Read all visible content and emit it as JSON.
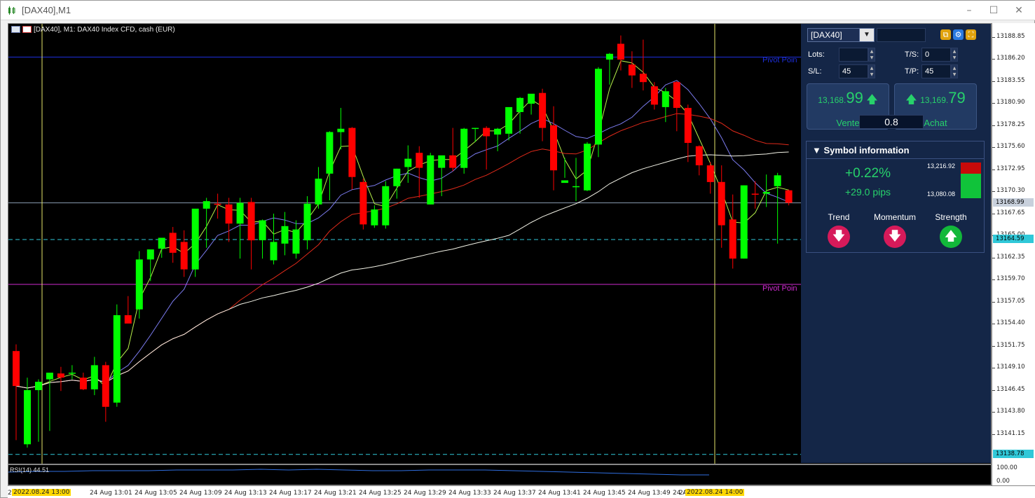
{
  "window": {
    "title": "[DAX40],M1",
    "icon": "chart-candles-icon",
    "colors": {
      "bg": "#000000",
      "panel": "#142647",
      "bull": "#00ff00",
      "bear": "#ff0000",
      "accent_green": "#27d16b"
    }
  },
  "chart": {
    "header": "[DAX40], M1:  DAX40 Index CFD, cash (EUR)",
    "pivot_label_1": "Pivot Poin",
    "pivot_label_2": "Pivot Poin",
    "rsi_label": "RSI(14) 44.51",
    "price_labels": [
      "13188.85",
      "13186.20",
      "13183.55",
      "13180.90",
      "13178.25",
      "13175.60",
      "13172.95",
      "13170.30",
      "13167.65",
      "13165.00",
      "13162.35",
      "13159.70",
      "13157.05",
      "13154.40",
      "13151.75",
      "13149.10",
      "13146.45",
      "13143.80",
      "13141.15"
    ],
    "current_price_badge": "13168.99",
    "cyan_badge": "13164.59",
    "low_badge": "13138.78",
    "rsi_scale_top": "100.00",
    "rsi_scale_bottom": "0.00",
    "time_labels": [
      "24 Aug 13:01",
      "24 Aug 13:05",
      "24 Aug 13:09",
      "24 Aug 13:13",
      "24 Aug 13:17",
      "24 Aug 13:21",
      "24 Aug 13:25",
      "24 Aug 13:29",
      "24 Aug 13:33",
      "24 Aug 13:37",
      "24 Aug 13:41",
      "24 Aug 13:45",
      "24 Aug 13:49",
      "24 Aug 13:53"
    ],
    "time_left_prefix": "24",
    "time_right_prefix": "24",
    "time_marker_start": "2022.08.24 13:00",
    "time_marker_end": "2022.08.24 14:00"
  },
  "chart_data": {
    "type": "candlestick",
    "ylim": [
      13137.5,
      13190.5
    ],
    "candles": [
      {
        "o": 13151.2,
        "h": 13152.0,
        "l": 13140.5,
        "c": 13147.0
      },
      {
        "o": 13140.0,
        "h": 13148.0,
        "l": 13139.6,
        "c": 13146.5
      },
      {
        "o": 13146.5,
        "h": 13147.8,
        "l": 13140.3,
        "c": 13147.5
      },
      {
        "o": 13147.8,
        "h": 13148.3,
        "l": 13141.6,
        "c": 13148.6
      },
      {
        "o": 13148.5,
        "h": 13149.3,
        "l": 13146.4,
        "c": 13148.0
      },
      {
        "o": 13148.6,
        "h": 13149.5,
        "l": 13147.8,
        "c": 13148.6
      },
      {
        "o": 13148.0,
        "h": 13148.6,
        "l": 13146.5,
        "c": 13146.6
      },
      {
        "o": 13146.6,
        "h": 13150.5,
        "l": 13145.9,
        "c": 13149.5
      },
      {
        "o": 13149.5,
        "h": 13149.9,
        "l": 13142.7,
        "c": 13144.5
      },
      {
        "o": 13145.0,
        "h": 13156.8,
        "l": 13144.5,
        "c": 13155.5
      },
      {
        "o": 13155.5,
        "h": 13157.8,
        "l": 13154.7,
        "c": 13154.5
      },
      {
        "o": 13156.2,
        "h": 13163.2,
        "l": 13155.1,
        "c": 13162.2
      },
      {
        "o": 13162.2,
        "h": 13163.2,
        "l": 13159.6,
        "c": 13163.4
      },
      {
        "o": 13163.5,
        "h": 13164.4,
        "l": 13162.4,
        "c": 13164.8
      },
      {
        "o": 13165.4,
        "h": 13166.1,
        "l": 13161.8,
        "c": 13163.0
      },
      {
        "o": 13164.3,
        "h": 13165.7,
        "l": 13160.1,
        "c": 13161.0
      },
      {
        "o": 13161.0,
        "h": 13168.0,
        "l": 13160.1,
        "c": 13168.3
      },
      {
        "o": 13168.3,
        "h": 13169.6,
        "l": 13163.6,
        "c": 13169.2
      },
      {
        "o": 13168.9,
        "h": 13170.1,
        "l": 13167.1,
        "c": 13168.8
      },
      {
        "o": 13168.8,
        "h": 13169.6,
        "l": 13164.3,
        "c": 13166.5
      },
      {
        "o": 13166.5,
        "h": 13169.6,
        "l": 13162.3,
        "c": 13169.0
      },
      {
        "o": 13169.1,
        "h": 13169.6,
        "l": 13161.0,
        "c": 13164.5
      },
      {
        "o": 13164.5,
        "h": 13167.0,
        "l": 13162.3,
        "c": 13166.9
      },
      {
        "o": 13162.1,
        "h": 13167.7,
        "l": 13161.6,
        "c": 13164.3
      },
      {
        "o": 13164.1,
        "h": 13167.9,
        "l": 13162.7,
        "c": 13166.2
      },
      {
        "o": 13162.9,
        "h": 13166.9,
        "l": 13162.3,
        "c": 13165.8
      },
      {
        "o": 13164.5,
        "h": 13169.8,
        "l": 13163.4,
        "c": 13168.9
      },
      {
        "o": 13168.8,
        "h": 13173.3,
        "l": 13168.3,
        "c": 13171.9
      },
      {
        "o": 13172.5,
        "h": 13177.6,
        "l": 13169.3,
        "c": 13177.5
      },
      {
        "o": 13177.5,
        "h": 13180.4,
        "l": 13175.4,
        "c": 13177.9
      },
      {
        "o": 13178.0,
        "h": 13178.1,
        "l": 13170.6,
        "c": 13172.1
      },
      {
        "o": 13171.5,
        "h": 13171.9,
        "l": 13165.8,
        "c": 13166.4
      },
      {
        "o": 13166.3,
        "h": 13168.7,
        "l": 13166.0,
        "c": 13168.2
      },
      {
        "o": 13166.3,
        "h": 13171.6,
        "l": 13165.9,
        "c": 13171.0
      },
      {
        "o": 13171.0,
        "h": 13173.1,
        "l": 13169.5,
        "c": 13173.1
      },
      {
        "o": 13173.3,
        "h": 13175.9,
        "l": 13171.4,
        "c": 13174.3
      },
      {
        "o": 13175.0,
        "h": 13175.8,
        "l": 13169.6,
        "c": 13173.2
      },
      {
        "o": 13168.8,
        "h": 13175.0,
        "l": 13168.8,
        "c": 13174.7
      },
      {
        "o": 13173.2,
        "h": 13173.6,
        "l": 13169.8,
        "c": 13174.7
      },
      {
        "o": 13174.7,
        "h": 13178.0,
        "l": 13172.8,
        "c": 13173.2
      },
      {
        "o": 13173.2,
        "h": 13178.0,
        "l": 13172.5,
        "c": 13177.9
      },
      {
        "o": 13177.9,
        "h": 13178.0,
        "l": 13176.3,
        "c": 13178.0
      },
      {
        "o": 13178.0,
        "h": 13178.2,
        "l": 13173.0,
        "c": 13177.0
      },
      {
        "o": 13177.2,
        "h": 13178.0,
        "l": 13175.2,
        "c": 13177.9
      },
      {
        "o": 13177.3,
        "h": 13180.1,
        "l": 13176.5,
        "c": 13180.5
      },
      {
        "o": 13179.9,
        "h": 13181.7,
        "l": 13177.3,
        "c": 13181.6
      },
      {
        "o": 13180.9,
        "h": 13181.7,
        "l": 13179.6,
        "c": 13182.1
      },
      {
        "o": 13182.2,
        "h": 13182.7,
        "l": 13176.4,
        "c": 13178.0
      },
      {
        "o": 13178.3,
        "h": 13180.6,
        "l": 13170.5,
        "c": 13172.9
      },
      {
        "o": 13171.4,
        "h": 13174.4,
        "l": 13172.0,
        "c": 13171.7
      },
      {
        "o": 13171.0,
        "h": 13174.4,
        "l": 13169.2,
        "c": 13171.0
      },
      {
        "o": 13170.5,
        "h": 13176.3,
        "l": 13170.4,
        "c": 13176.1
      },
      {
        "o": 13176.0,
        "h": 13185.3,
        "l": 13174.5,
        "c": 13185.1
      },
      {
        "o": 13186.2,
        "h": 13187.0,
        "l": 13183.2,
        "c": 13186.9
      },
      {
        "o": 13188.1,
        "h": 13189.1,
        "l": 13184.9,
        "c": 13186.2
      },
      {
        "o": 13185.6,
        "h": 13187.2,
        "l": 13182.8,
        "c": 13184.3
      },
      {
        "o": 13184.5,
        "h": 13188.6,
        "l": 13182.5,
        "c": 13183.5
      },
      {
        "o": 13183.0,
        "h": 13183.5,
        "l": 13180.2,
        "c": 13180.8
      },
      {
        "o": 13180.5,
        "h": 13182.8,
        "l": 13178.7,
        "c": 13182.4
      },
      {
        "o": 13183.5,
        "h": 13183.6,
        "l": 13177.6,
        "c": 13180.4
      },
      {
        "o": 13180.4,
        "h": 13180.8,
        "l": 13173.9,
        "c": 13176.2
      },
      {
        "o": 13175.8,
        "h": 13175.9,
        "l": 13172.3,
        "c": 13173.5
      },
      {
        "o": 13173.5,
        "h": 13173.9,
        "l": 13170.1,
        "c": 13171.5
      },
      {
        "o": 13171.5,
        "h": 13173.5,
        "l": 13163.6,
        "c": 13166.3
      },
      {
        "o": 13167.0,
        "h": 13170.0,
        "l": 13161.1,
        "c": 13162.3
      },
      {
        "o": 13162.3,
        "h": 13171.1,
        "l": 13162.3,
        "c": 13171.1
      },
      {
        "o": 13170.1,
        "h": 13171.6,
        "l": 13168.3,
        "c": 13170.0
      },
      {
        "o": 13170.1,
        "h": 13172.4,
        "l": 13168.5,
        "c": 13170.3
      },
      {
        "o": 13171.0,
        "h": 13172.6,
        "l": 13164.1,
        "c": 13172.3
      },
      {
        "o": 13170.5,
        "h": 13170.6,
        "l": 13168.7,
        "c": 13169.0
      }
    ],
    "pivot_line_1": 13186.5,
    "pivot_line_2": 13159.2,
    "horizontal_line_current": 13168.99,
    "cyan_dashed_line": 13164.59,
    "cyan_dashed_low": 13138.78
  },
  "panel": {
    "symbol": "[DAX40]",
    "lots_label": "Lots:",
    "lots_value": "",
    "ts_label": "T/S:",
    "ts_value": "0",
    "sl_label": "S/L:",
    "sl_value": "45",
    "tp_label": "T/P:",
    "tp_value": "45",
    "sell_price_small": "13,168.",
    "sell_price_big": "99",
    "sell_label": "Vente",
    "buy_price_small": "13,169.",
    "buy_price_big": "79",
    "buy_label": "Achat",
    "spread": "0.8",
    "syminfo_title": "Symbol information",
    "change_pct": "+0.22%",
    "change_pips": "+29.0 pips",
    "high": "13,216.92",
    "low": "13,080.08",
    "trend_label": "Trend",
    "momentum_label": "Momentum",
    "strength_label": "Strength"
  }
}
